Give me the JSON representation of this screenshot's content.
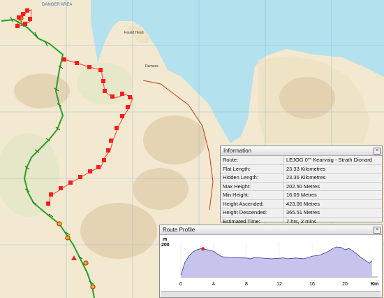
{
  "map": {
    "top_label": "DANGER AREA",
    "place_labels": [
      "Faraid Head",
      "Durness"
    ]
  },
  "info_panel": {
    "title": "Information",
    "rows": [
      {
        "key": "Route:",
        "value": "LEJOG 0\"\" Kearvaig - Strath Dionard"
      },
      {
        "key": "Flat Length:",
        "value": "23.33 Kilometres"
      },
      {
        "key": "Hidden Length:",
        "value": "23.36 Kilometres"
      },
      {
        "key": "Max Height:",
        "value": "202.50 Metres"
      },
      {
        "key": "Min Height:",
        "value": "16.09 Metres"
      },
      {
        "key": "Height Ascended:",
        "value": "423.06 Metres"
      },
      {
        "key": "Height Descended:",
        "value": "365.51 Metres"
      },
      {
        "key": "Estimated Time:",
        "value": "7 hrs, 2 mins"
      }
    ]
  },
  "route_profile": {
    "title": "Route Profile",
    "y_unit": "m",
    "y_tick": "200",
    "x_unit": "Km",
    "x_ticks": [
      "0",
      "4",
      "8",
      "12",
      "16",
      "20"
    ],
    "fill_color": "#c6c4ec",
    "line_color": "#3a3a9a",
    "marker_color": "#e02020"
  },
  "chart_data": {
    "type": "area",
    "title": "",
    "xlabel": "Km",
    "ylabel": "m",
    "xlim": [
      0,
      24
    ],
    "ylim": [
      0,
      215
    ],
    "x": [
      0,
      0.5,
      1,
      1.5,
      2,
      2.5,
      3,
      3.5,
      4,
      4.5,
      5,
      6,
      7,
      8,
      8.5,
      9,
      10,
      11,
      12,
      12.5,
      13,
      14,
      15,
      16,
      17,
      18,
      18.5,
      19,
      19.5,
      20,
      20.5,
      21,
      22,
      23,
      23.3
    ],
    "y": [
      12,
      90,
      130,
      155,
      168,
      175,
      170,
      165,
      158,
      140,
      125,
      120,
      118,
      117,
      112,
      120,
      116,
      112,
      115,
      118,
      112,
      117,
      112,
      128,
      135,
      158,
      175,
      185,
      182,
      168,
      175,
      160,
      118,
      85,
      100
    ],
    "marker_x": 2.7
  },
  "colors": {
    "route_red": "#ff1c1c",
    "track_green": "#2aa22a",
    "sea": "#aee1ee",
    "land": "#f4ead2"
  }
}
